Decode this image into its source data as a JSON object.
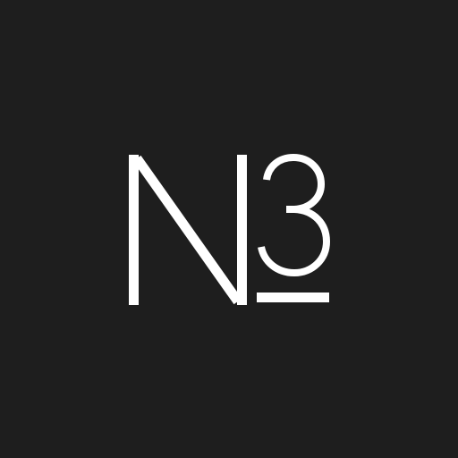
{
  "background_color": "#1e1e1e",
  "logo": {
    "mark_text": "N3",
    "mark_color": "#ffffff",
    "icon": "n3-monogram-icon"
  }
}
